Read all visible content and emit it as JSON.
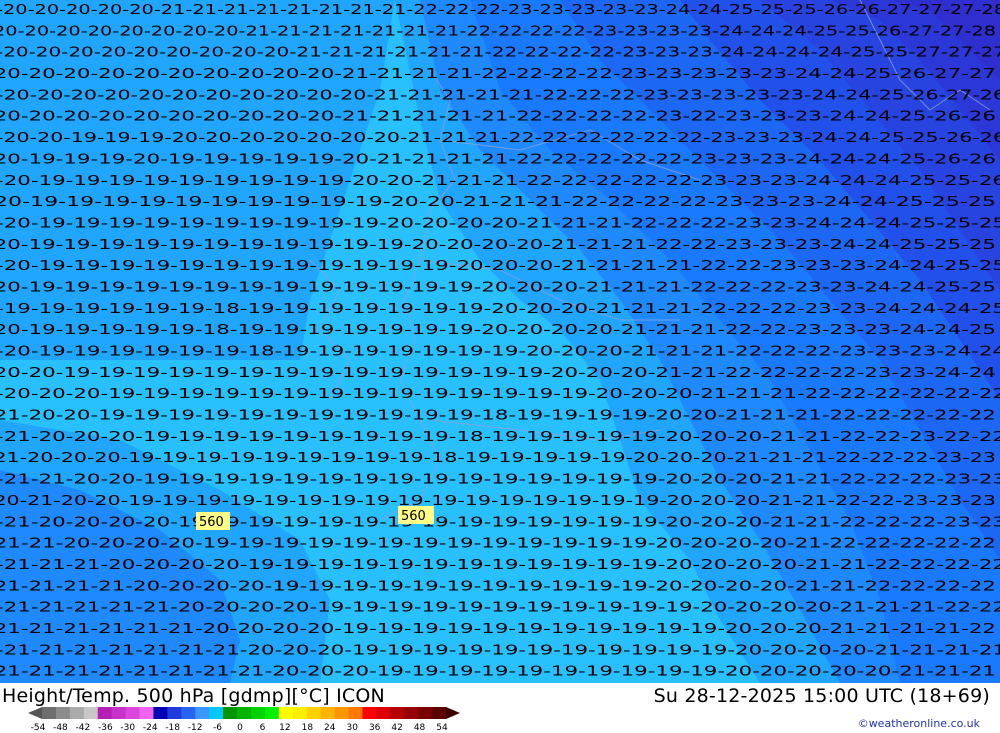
{
  "map": {
    "colors": {
      "band_19": "#29c0ff",
      "band_20": "#21a6ff",
      "band_21": "#1f8aff",
      "band_22": "#1a7aff",
      "band_23": "#1d67f5",
      "band_24": "#2150ea",
      "band_25": "#2743e0",
      "band_26": "#2c37d8",
      "band_27": "#2f2fcf"
    },
    "height_labels": [
      "560",
      "560"
    ],
    "temperature_rows": [
      "-20-20-20-20-20-21-21-21-21-21-21-21-21-22-22-22-23-23-23-23-23-24-24-25-25-25-26-26-27-27-27-28",
      "-20-20-20-20-20-20-20-20-21-21-21-21-21-21-21-22-22-22-22-23-23-23-23-24-24-24-25-25-26-27-27-28",
      "-20-20-20-20-20-20-20-20-20-21-21-21-21-21-21-22-22-22-22-23-23-23-24-24-24-24-25-25-27-27-27",
      "-20-20-20-20-20-20-20-20-20-20-21-21-21-21-22-22-22-22-23-23-23-23-23-24-24-25-26-27-27",
      "-20-20-20-20-20-20-20-20-20-20-20-21-21-21-21-21-22-22-22-23-23-23-23-23-24-24-25-26-27-26",
      "-20-20-20-20-20-20-20-20-20-20-21-21-21-21-21-22-22-22-22-23-22-23-23-23-24-24-25-26-26",
      "-20-20-19-19-19-20-20-20-20-20-20-20-21-21-21-22-22-22-22-22-22-23-23-23-24-24-25-25-26-26",
      "-20-19-19-19-20-19-19-19-19-19-20-21-21-21-21-22-22-22-22-22-23-23-23-24-24-24-25-26-26",
      "-20-19-19-19-19-19-19-19-19-19-20-20-21-21-21-22-22-22-22-22-23-23-23-24-24-24-25-25-26",
      "-20-19-19-19-19-19-19-19-19-19-19-20-20-21-21-21-22-22-22-22-23-23-23-24-24-25-25-25",
      "-20-19-19-19-19-19-19-19-19-19-19-20-20-20-20-21-21-21-22-22-22-23-23-24-24-24-25-25-25",
      "-20-19-19-19-19-19-19-19-19-19-19-19-20-20-20-20-21-21-21-22-22-23-23-23-24-24-25-25-25",
      "-20-19-19-19-19-19-19-19-19-19-19-19-19-20-20-20-21-21-21-21-22-22-23-23-23-24-24-25-25",
      "-20-19-19-19-19-19-19-19-19-19-19-19-19-19-20-20-20-21-21-21-22-22-22-23-23-24-24-25-25",
      "-19-19-19-19-19-19-18-19-19-19-19-19-19-19-20-20-20-21-21-21-22-22-22-23-23-24-24-24-25",
      "-20-19-19-19-19-19-18-19-19-19-19-19-19-19-20-20-20-20-21-21-21-22-22-23-23-23-24-24-25",
      "-20-19-19-19-19-19-19-18-19-19-19-19-19-19-19-20-20-20-21-21-21-22-22-22-23-23-23-24-24",
      "-20-20-19-19-19-19-19-19-19-19-19-19-19-19-19-19-20-20-20-21-21-22-22-22-22-23-23-24-24",
      "-20-20-20-19-19-19-19-19-19-19-19-19-19-19-19-19-19-20-20-20-21-21-21-22-22-22-22-22-22",
      "-21-20-20-19-19-19-19-19-19-19-19-19-19-19-18-19-19-19-19-20-20-21-21-21-22-22-22-22-22",
      "-21-20-20-20-19-19-19-19-19-19-19-19-19-18-19-19-19-19-19-20-20-20-21-21-22-22-23-22-22",
      "-21-20-20-20-19-19-19-19-19-19-19-19-19-18-19-19-19-19-19-20-20-20-21-21-21-22-22-22-23-23",
      "-21-21-20-20-19-19-19-19-19-19-19-19-19-19-19-19-19-19-19-20-20-20-21-21-22-22-22-23-23",
      "-20-21-20-20-19-19-19-19-19-19-19-19-19-19-19-19-19-19-19-19-20-20-20-21-21-22-22-23-23-23",
      "-21-20-20-20-20-19-19-19-19-19-19-19-19-19-19-19-19-19-19-20-20-20-21-21-22-22-22-23-23",
      "-21-21-20-20-20-20-19-19-19-19-19-19-19-19-19-19-19-19-19-20-20-20-20-21-22-22-22-22-22",
      "-21-21-21-20-20-20-20-19-19-19-19-19-19-19-19-19-19-19-19-20-20-20-20-21-21-22-22-22-22",
      "-21-21-21-21-20-20-20-20-19-19-19-19-19-19-19-19-19-19-19-20-20-20-20-21-21-22-22-22-22",
      "-21-21-21-21-21-20-20-20-20-19-19-19-19-19-19-19-19-19-19-19-20-20-20-20-21-21-21-22-22",
      "-21-21-21-21-21-21-20-20-20-20-19-19-19-19-19-19-19-19-19-19-19-20-20-20-21-21-21-21-22",
      "-21-21-21-21-21-21-21-20-20-20-19-19-19-19-19-19-19-19-19-19-19-20-20-20-20-21-21-21-21",
      "-21-21-21-21-21-21-21-21-20-20-20-19-19-19-19-19-19-19-19-19-19-20-20-20-20-20-21-21-21"
    ]
  },
  "footer": {
    "title_left": "Height/Temp. 500 hPa [gdmp][°C] ICON",
    "title_right": "Su 28-12-2025 15:00 UTC (18+69)",
    "credit": "©weatheronline.co.uk"
  },
  "legend": {
    "colors": [
      "#6e6e6e",
      "#8c8c8c",
      "#aaaaaa",
      "#c8c8c8",
      "#b420b4",
      "#c832c8",
      "#dc46dc",
      "#f064f0",
      "#0000b4",
      "#1e3cdc",
      "#2864f0",
      "#3c96ff",
      "#00c8ff",
      "#009600",
      "#00b400",
      "#00d200",
      "#00f000",
      "#ffff00",
      "#fff000",
      "#ffd200",
      "#ffb400",
      "#ff9600",
      "#ff7800",
      "#ff0000",
      "#dc0000",
      "#b40000",
      "#960000",
      "#780000",
      "#5a0000"
    ],
    "labels": [
      "-54",
      "-48",
      "-42",
      "-36",
      "-30",
      "-24",
      "-18",
      "-12",
      "-6",
      "0",
      "6",
      "12",
      "18",
      "24",
      "30",
      "36",
      "42",
      "48",
      "54"
    ]
  }
}
